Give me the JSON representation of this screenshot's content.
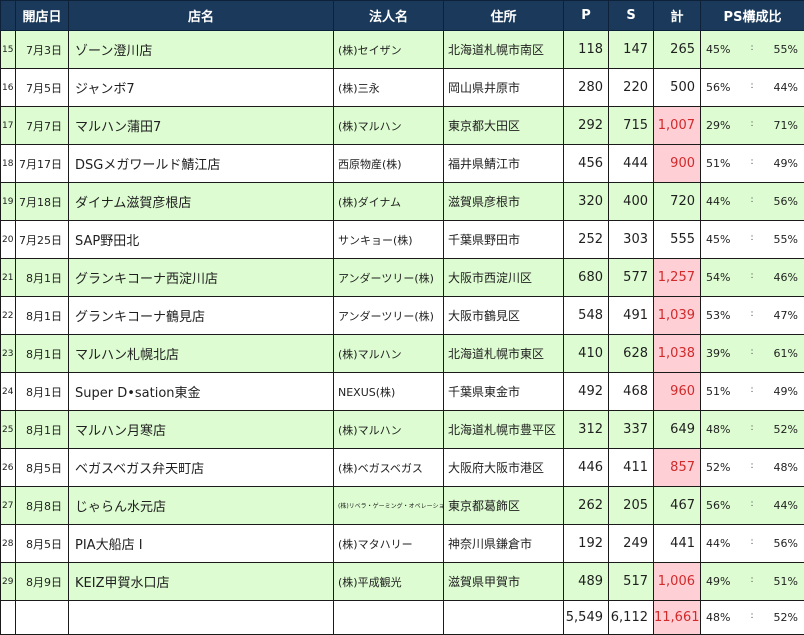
{
  "headers": {
    "date": "開店日",
    "name": "店名",
    "corp": "法人名",
    "addr": "住所",
    "p": "P",
    "s": "S",
    "total": "計",
    "ps": "PS構成比"
  },
  "ps_separator": ":",
  "rows": [
    {
      "no": "15",
      "date": "7月3日",
      "name": "ゾーン澄川店",
      "corp": "(株)セイザン",
      "addr": "北海道札幌市南区",
      "p": "118",
      "s": "147",
      "total": "265",
      "p_pct": "45%",
      "s_pct": "55%",
      "highlight": false
    },
    {
      "no": "16",
      "date": "7月5日",
      "name": "ジャンボ7",
      "corp": "(株)三永",
      "addr": "岡山県井原市",
      "p": "280",
      "s": "220",
      "total": "500",
      "p_pct": "56%",
      "s_pct": "44%",
      "highlight": false
    },
    {
      "no": "17",
      "date": "7月7日",
      "name": "マルハン蒲田7",
      "corp": "(株)マルハン",
      "addr": "東京都大田区",
      "p": "292",
      "s": "715",
      "total": "1,007",
      "p_pct": "29%",
      "s_pct": "71%",
      "highlight": true
    },
    {
      "no": "18",
      "date": "7月17日",
      "name": "DSGメガワールド鯖江店",
      "corp": "西原物産(株)",
      "addr": "福井県鯖江市",
      "p": "456",
      "s": "444",
      "total": "900",
      "p_pct": "51%",
      "s_pct": "49%",
      "highlight": true
    },
    {
      "no": "19",
      "date": "7月18日",
      "name": "ダイナム滋賀彦根店",
      "corp": "(株)ダイナム",
      "addr": "滋賀県彦根市",
      "p": "320",
      "s": "400",
      "total": "720",
      "p_pct": "44%",
      "s_pct": "56%",
      "highlight": false
    },
    {
      "no": "20",
      "date": "7月25日",
      "name": "SAP野田北",
      "corp": "サンキョー(株)",
      "addr": "千葉県野田市",
      "p": "252",
      "s": "303",
      "total": "555",
      "p_pct": "45%",
      "s_pct": "55%",
      "highlight": false
    },
    {
      "no": "21",
      "date": "8月1日",
      "name": "グランキコーナ西淀川店",
      "corp": "アンダーツリー(株)",
      "addr": "大阪市西淀川区",
      "p": "680",
      "s": "577",
      "total": "1,257",
      "p_pct": "54%",
      "s_pct": "46%",
      "highlight": true
    },
    {
      "no": "22",
      "date": "8月1日",
      "name": "グランキコーナ鶴見店",
      "corp": "アンダーツリー(株)",
      "addr": "大阪市鶴見区",
      "p": "548",
      "s": "491",
      "total": "1,039",
      "p_pct": "53%",
      "s_pct": "47%",
      "highlight": true
    },
    {
      "no": "23",
      "date": "8月1日",
      "name": "マルハン札幌北店",
      "corp": "(株)マルハン",
      "addr": "北海道札幌市東区",
      "p": "410",
      "s": "628",
      "total": "1,038",
      "p_pct": "39%",
      "s_pct": "61%",
      "highlight": true
    },
    {
      "no": "24",
      "date": "8月1日",
      "name": "Super D•sation東金",
      "corp": "NEXUS(株)",
      "addr": "千葉県東金市",
      "p": "492",
      "s": "468",
      "total": "960",
      "p_pct": "51%",
      "s_pct": "49%",
      "highlight": true
    },
    {
      "no": "25",
      "date": "8月1日",
      "name": "マルハン月寒店",
      "corp": "(株)マルハン",
      "addr": "北海道札幌市豊平区",
      "p": "312",
      "s": "337",
      "total": "649",
      "p_pct": "48%",
      "s_pct": "52%",
      "highlight": false
    },
    {
      "no": "26",
      "date": "8月5日",
      "name": "ベガスベガス弁天町店",
      "corp": "(株)ベガスベガス",
      "addr": "大阪府大阪市港区",
      "p": "446",
      "s": "411",
      "total": "857",
      "p_pct": "52%",
      "s_pct": "48%",
      "highlight": true
    },
    {
      "no": "27",
      "date": "8月8日",
      "name": "じゃらん水元店",
      "corp": "(株)リベラ・ゲーミング・オペレーションズ",
      "addr": "東京都葛飾区",
      "p": "262",
      "s": "205",
      "total": "467",
      "p_pct": "56%",
      "s_pct": "44%",
      "highlight": false
    },
    {
      "no": "28",
      "date": "8月5日",
      "name": "PIA大船店 I",
      "corp": "(株)マタハリー",
      "addr": "神奈川県鎌倉市",
      "p": "192",
      "s": "249",
      "total": "441",
      "p_pct": "44%",
      "s_pct": "56%",
      "highlight": false
    },
    {
      "no": "29",
      "date": "8月9日",
      "name": "KEIZ甲賀水口店",
      "corp": "(株)平成観光",
      "addr": "滋賀県甲賀市",
      "p": "489",
      "s": "517",
      "total": "1,006",
      "p_pct": "49%",
      "s_pct": "51%",
      "highlight": true
    }
  ],
  "totals": {
    "p": "5,549",
    "s": "6,112",
    "total": "11,661",
    "p_pct": "48%",
    "s_pct": "52%"
  },
  "colors": {
    "header_bg": "#1b3a5b",
    "row_green": "#ddfcd1",
    "highlight_bg": "#ffcfd6",
    "highlight_text": "#d12a2a"
  }
}
